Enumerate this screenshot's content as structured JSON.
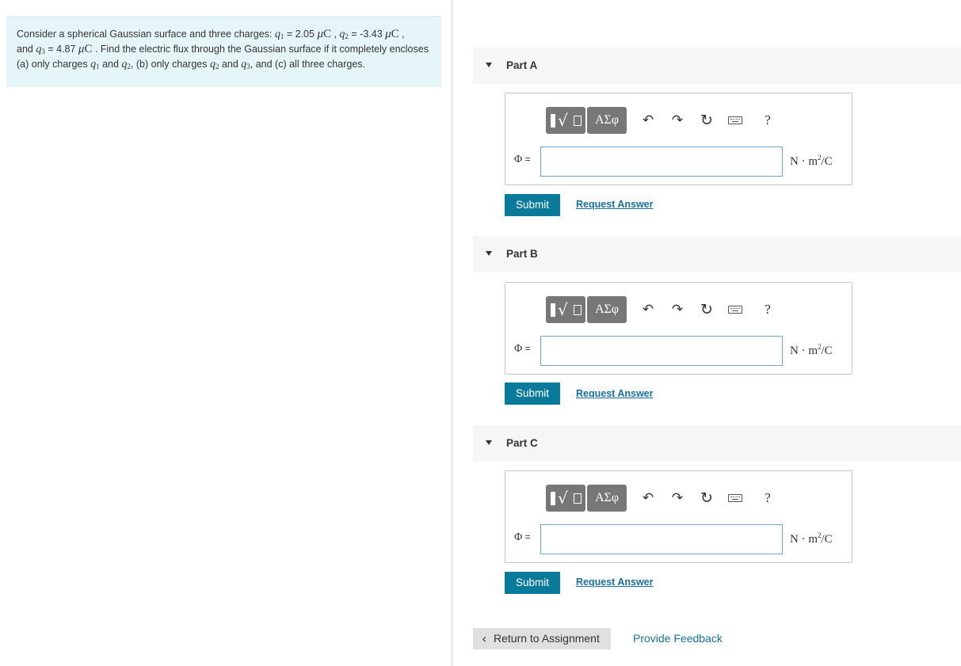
{
  "problem": {
    "prefix": "Consider a spherical Gaussian surface and three charges: ",
    "q1": {
      "symbol": "q",
      "sub": "1",
      "value": " = 2.05 ",
      "unit_mu": "μ",
      "unit_c": "C"
    },
    "q2": {
      "symbol": "q",
      "sub": "2",
      "value": " = -3.43 ",
      "unit_mu": "μ",
      "unit_c": "C"
    },
    "q3": {
      "symbol": "q",
      "sub": "3",
      "value": " = 4.87 ",
      "unit_mu": "μ",
      "unit_c": "C"
    },
    "and": "and ",
    "comma": " , ",
    "comma_end": " ,",
    "text_after_q3": " . Find the electric flux through the Gaussian surface if it completely encloses (a) only charges ",
    "and_mid": " and ",
    "text_b": ", (b)  only charges ",
    "text_c": ", and (c) all three charges."
  },
  "toolbar": {
    "templates_radical": "√",
    "greek_label": "ΑΣφ",
    "undo_glyph": "↶",
    "redo_glyph": "↷",
    "reset_glyph": "↻",
    "help_label": "?"
  },
  "parts": [
    {
      "label": "Part A",
      "phi_symbol": "Φ",
      "equals": " =",
      "input_value": "",
      "unit_base": "N · m",
      "unit_sup": "2",
      "unit_tail": "/C",
      "submit_label": "Submit",
      "request_label": "Request Answer"
    },
    {
      "label": "Part B",
      "phi_symbol": "Φ",
      "equals": " =",
      "input_value": "",
      "unit_base": "N · m",
      "unit_sup": "2",
      "unit_tail": "/C",
      "submit_label": "Submit",
      "request_label": "Request Answer"
    },
    {
      "label": "Part C",
      "phi_symbol": "Φ",
      "equals": " =",
      "input_value": "",
      "unit_base": "N · m",
      "unit_sup": "2",
      "unit_tail": "/C",
      "submit_label": "Submit",
      "request_label": "Request Answer"
    }
  ],
  "footer": {
    "return_chevron": "‹",
    "return_label": "Return to Assignment",
    "feedback_label": "Provide Feedback"
  },
  "colors": {
    "submit_bg": "#0a7a9b",
    "link": "#1a6f9a",
    "problem_bg": "#e6f6f8",
    "input_border": "#6fa6c7",
    "toolbar_btn": "#777777"
  }
}
